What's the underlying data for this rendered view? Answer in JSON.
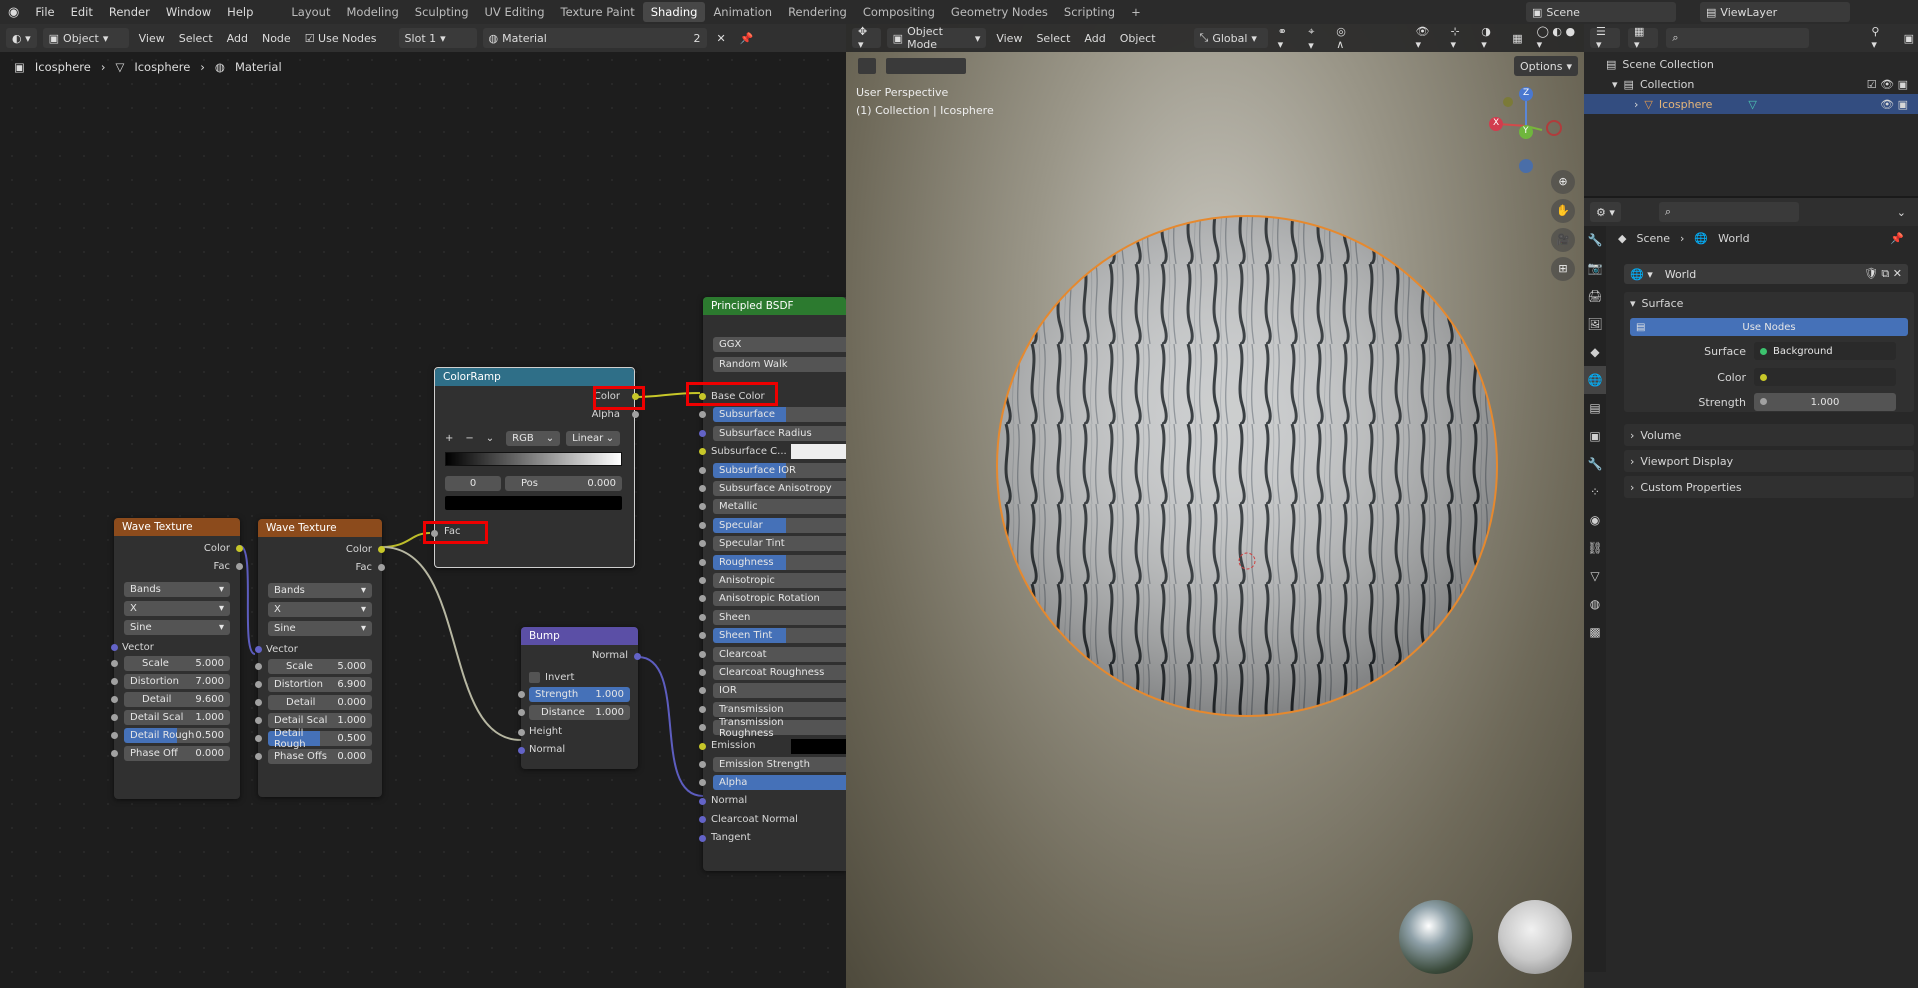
{
  "menubar": {
    "items": [
      "File",
      "Edit",
      "Render",
      "Window",
      "Help"
    ],
    "workspaces": [
      "Layout",
      "Modeling",
      "Sculpting",
      "UV Editing",
      "Texture Paint",
      "Shading",
      "Animation",
      "Rendering",
      "Compositing",
      "Geometry Nodes",
      "Scripting",
      "+"
    ],
    "active_workspace": "Shading",
    "scene": "Scene",
    "view_layer": "ViewLayer"
  },
  "node_editor": {
    "object_mode": "Object",
    "menus": [
      "View",
      "Select",
      "Add",
      "Node"
    ],
    "use_nodes": "Use Nodes",
    "slot": "Slot 1",
    "material": "Material",
    "users": "2",
    "breadcrumb": [
      "Icosphere",
      "Icosphere",
      "Material"
    ],
    "wave1": {
      "title": "Wave Texture",
      "out_color": "Color",
      "out_fac": "Fac",
      "type": "Bands",
      "dir": "X",
      "profile": "Sine",
      "vector": "Vector",
      "scale_l": "Scale",
      "scale_v": "5.000",
      "dist_l": "Distortion",
      "dist_v": "7.000",
      "detail_l": "Detail",
      "detail_v": "9.600",
      "dscale_l": "Detail Scal",
      "dscale_v": "1.000",
      "drough_l": "Detail Rough",
      "drough_v": "0.500",
      "phase_l": "Phase Off",
      "phase_v": "0.000"
    },
    "wave2": {
      "title": "Wave Texture",
      "out_color": "Color",
      "out_fac": "Fac",
      "type": "Bands",
      "dir": "X",
      "profile": "Sine",
      "vector": "Vector",
      "scale_l": "Scale",
      "scale_v": "5.000",
      "dist_l": "Distortion",
      "dist_v": "6.900",
      "detail_l": "Detail",
      "detail_v": "0.000",
      "dscale_l": "Detail Scal",
      "dscale_v": "1.000",
      "drough_l": "Detail Rough",
      "drough_v": "0.500",
      "phase_l": "Phase Offs",
      "phase_v": "0.000"
    },
    "colorramp": {
      "title": "ColorRamp",
      "out_color": "Color",
      "out_alpha": "Alpha",
      "plus": "+",
      "minus": "−",
      "mode": "RGB",
      "interp": "Linear",
      "index": "0",
      "pos_l": "Pos",
      "pos_v": "0.000",
      "fac": "Fac"
    },
    "bump": {
      "title": "Bump",
      "out_normal": "Normal",
      "invert": "Invert",
      "strength_l": "Strength",
      "strength_v": "1.000",
      "distance_l": "Distance",
      "distance_v": "1.000",
      "height": "Height",
      "normal": "Normal"
    },
    "bsdf": {
      "title": "Principled BSDF",
      "dist": "GGX",
      "sss": "Random Walk",
      "inputs": [
        "Base Color",
        "Subsurface",
        "Subsurface Radius",
        "Subsurface C...",
        "Subsurface IOR",
        "Subsurface Anisotropy",
        "Metallic",
        "Specular",
        "Specular Tint",
        "Roughness",
        "Anisotropic",
        "Anisotropic Rotation",
        "Sheen",
        "Sheen Tint",
        "Clearcoat",
        "Clearcoat Roughness",
        "IOR",
        "Transmission",
        "Transmission Roughness",
        "Emission",
        "Emission Strength",
        "Alpha",
        "Normal",
        "Clearcoat Normal",
        "Tangent"
      ]
    }
  },
  "viewport": {
    "mode": "Object Mode",
    "menus": [
      "View",
      "Select",
      "Add",
      "Object"
    ],
    "transform": "Global",
    "options": "Options",
    "perspective": "User Perspective",
    "collection_info": "(1) Collection | Icosphere",
    "gizmo": {
      "z": "Z",
      "x": "X",
      "y": "Y"
    }
  },
  "outliner": {
    "scene_collection": "Scene Collection",
    "collection": "Collection",
    "object": "Icosphere"
  },
  "properties": {
    "breadcrumb_scene": "Scene",
    "breadcrumb_world": "World",
    "world_name": "World",
    "surface_label": "Surface",
    "use_nodes": "Use Nodes",
    "surface_field_l": "Surface",
    "surface_field_v": "Background",
    "color_l": "Color",
    "strength_l": "Strength",
    "strength_v": "1.000",
    "volume": "Volume",
    "viewport_display": "Viewport Display",
    "custom_props": "Custom Properties"
  }
}
